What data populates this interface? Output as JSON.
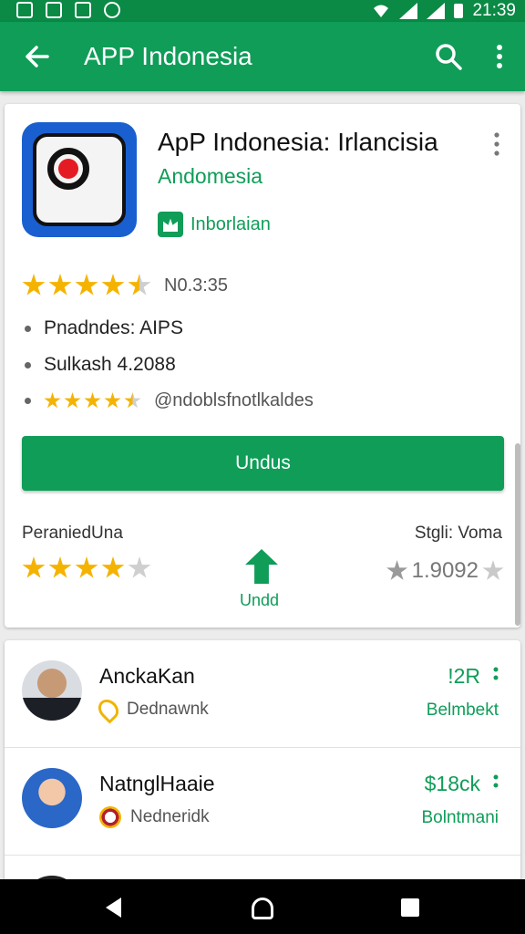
{
  "status_bar": {
    "time": "21:39"
  },
  "toolbar": {
    "title": "APP Indonesia",
    "back_icon": "arrow-left-icon",
    "search_icon": "search-icon",
    "menu_icon": "more-vert-icon"
  },
  "app": {
    "name": "ApP Indonesia: Irlancisia",
    "developer": "Andomesia",
    "badge_label": "Inborlaian",
    "rating_text": "N0.3:35",
    "info_lines": [
      "Pnadndes: AIPS",
      "Sulkash 4.2088"
    ],
    "info_line3_text": "@ndoblsfnotlkaldes",
    "install_label": "Undus",
    "stat_left_label": "PeraniedUna",
    "stat_right_label": "Stgli: Voma",
    "stat_center_label": "Undd",
    "stat_right_value": "1.9092"
  },
  "people": [
    {
      "name": "AnckaKan",
      "location": "Dednawnk",
      "price": "!2R",
      "sub": "Belmbekt"
    },
    {
      "name": "NatnglHaaie",
      "location": "Nedneridk",
      "price": "$18ck",
      "sub": "Bolntmani"
    }
  ],
  "colors": {
    "primary": "#0f9d58",
    "star": "#f5b301"
  }
}
